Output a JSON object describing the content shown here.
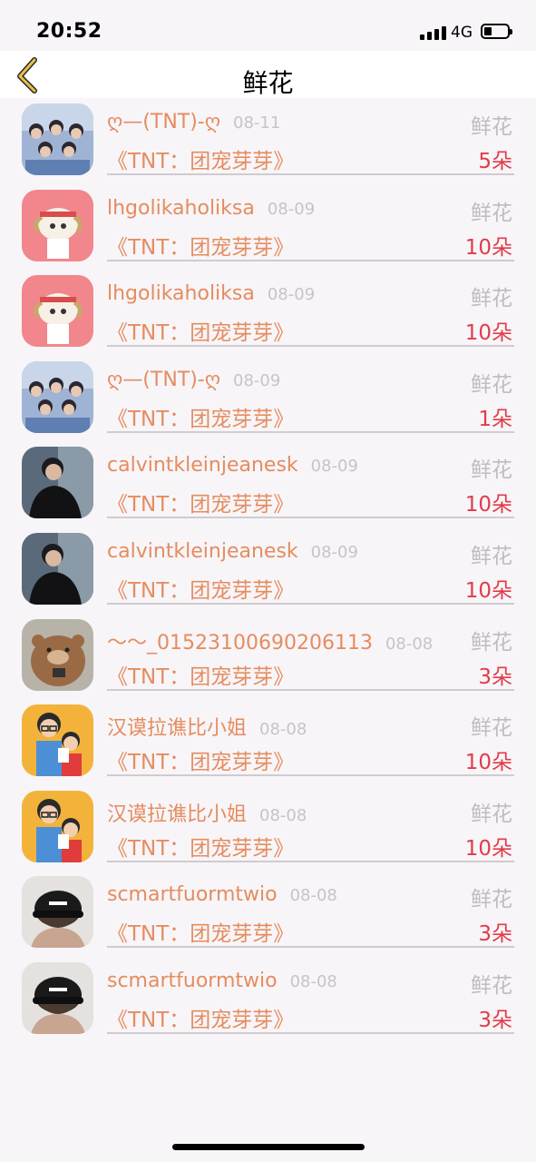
{
  "status": {
    "time": "20:52",
    "network": "4G"
  },
  "nav": {
    "title": "鲜花"
  },
  "items": [
    {
      "name": "ღ—(TNT)-ღ",
      "date": "08-11",
      "type": "鲜花",
      "gift": "《TNT：团宠芽芽》",
      "qty": "5朵",
      "avatar": "group-photo"
    },
    {
      "name": "lhgolikaholiksa",
      "date": "08-09",
      "type": "鲜花",
      "gift": "《TNT：团宠芽芽》",
      "qty": "10朵",
      "avatar": "sheep-cartoon"
    },
    {
      "name": "lhgolikaholiksa",
      "date": "08-09",
      "type": "鲜花",
      "gift": "《TNT：团宠芽芽》",
      "qty": "10朵",
      "avatar": "sheep-cartoon"
    },
    {
      "name": "ღ—(TNT)-ღ",
      "date": "08-09",
      "type": "鲜花",
      "gift": "《TNT：团宠芽芽》",
      "qty": "1朵",
      "avatar": "group-photo"
    },
    {
      "name": "calvintkleinjeanesk",
      "date": "08-09",
      "type": "鲜花",
      "gift": "《TNT：团宠芽芽》",
      "qty": "10朵",
      "avatar": "man-photo"
    },
    {
      "name": "calvintkleinjeanesk",
      "date": "08-09",
      "type": "鲜花",
      "gift": "《TNT：团宠芽芽》",
      "qty": "10朵",
      "avatar": "man-photo"
    },
    {
      "name": "～～_01523100690206113",
      "date": "08-08",
      "type": "鲜花",
      "gift": "《TNT：团宠芽芽》",
      "qty": "3朵",
      "avatar": "bear-cartoon"
    },
    {
      "name": "汉谟拉谯比小姐",
      "date": "08-08",
      "type": "鲜花",
      "gift": "《TNT：团宠芽芽》",
      "qty": "10朵",
      "avatar": "couple-cartoon"
    },
    {
      "name": "汉谟拉谯比小姐",
      "date": "08-08",
      "type": "鲜花",
      "gift": "《TNT：团宠芽芽》",
      "qty": "10朵",
      "avatar": "couple-cartoon"
    },
    {
      "name": "scmartfuormtwio",
      "date": "08-08",
      "type": "鲜花",
      "gift": "《TNT：团宠芽芽》",
      "qty": "3朵",
      "avatar": "cap-photo"
    },
    {
      "name": "scmartfuormtwio",
      "date": "08-08",
      "type": "鲜花",
      "gift": "《TNT：团宠芽芽》",
      "qty": "3朵",
      "avatar": "cap-photo"
    }
  ]
}
